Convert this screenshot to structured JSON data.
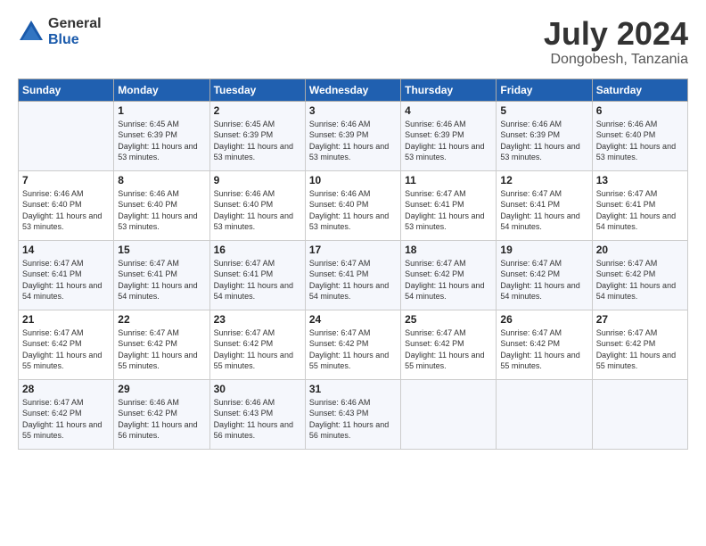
{
  "header": {
    "logo_general": "General",
    "logo_blue": "Blue",
    "title": "July 2024",
    "location": "Dongobesh, Tanzania"
  },
  "days_of_week": [
    "Sunday",
    "Monday",
    "Tuesday",
    "Wednesday",
    "Thursday",
    "Friday",
    "Saturday"
  ],
  "weeks": [
    [
      {
        "day": "",
        "info": ""
      },
      {
        "day": "1",
        "info": "Sunrise: 6:45 AM\nSunset: 6:39 PM\nDaylight: 11 hours\nand 53 minutes."
      },
      {
        "day": "2",
        "info": "Sunrise: 6:45 AM\nSunset: 6:39 PM\nDaylight: 11 hours\nand 53 minutes."
      },
      {
        "day": "3",
        "info": "Sunrise: 6:46 AM\nSunset: 6:39 PM\nDaylight: 11 hours\nand 53 minutes."
      },
      {
        "day": "4",
        "info": "Sunrise: 6:46 AM\nSunset: 6:39 PM\nDaylight: 11 hours\nand 53 minutes."
      },
      {
        "day": "5",
        "info": "Sunrise: 6:46 AM\nSunset: 6:39 PM\nDaylight: 11 hours\nand 53 minutes."
      },
      {
        "day": "6",
        "info": "Sunrise: 6:46 AM\nSunset: 6:40 PM\nDaylight: 11 hours\nand 53 minutes."
      }
    ],
    [
      {
        "day": "7",
        "info": "Sunrise: 6:46 AM\nSunset: 6:40 PM\nDaylight: 11 hours\nand 53 minutes."
      },
      {
        "day": "8",
        "info": "Sunrise: 6:46 AM\nSunset: 6:40 PM\nDaylight: 11 hours\nand 53 minutes."
      },
      {
        "day": "9",
        "info": "Sunrise: 6:46 AM\nSunset: 6:40 PM\nDaylight: 11 hours\nand 53 minutes."
      },
      {
        "day": "10",
        "info": "Sunrise: 6:46 AM\nSunset: 6:40 PM\nDaylight: 11 hours\nand 53 minutes."
      },
      {
        "day": "11",
        "info": "Sunrise: 6:47 AM\nSunset: 6:41 PM\nDaylight: 11 hours\nand 53 minutes."
      },
      {
        "day": "12",
        "info": "Sunrise: 6:47 AM\nSunset: 6:41 PM\nDaylight: 11 hours\nand 54 minutes."
      },
      {
        "day": "13",
        "info": "Sunrise: 6:47 AM\nSunset: 6:41 PM\nDaylight: 11 hours\nand 54 minutes."
      }
    ],
    [
      {
        "day": "14",
        "info": "Sunrise: 6:47 AM\nSunset: 6:41 PM\nDaylight: 11 hours\nand 54 minutes."
      },
      {
        "day": "15",
        "info": "Sunrise: 6:47 AM\nSunset: 6:41 PM\nDaylight: 11 hours\nand 54 minutes."
      },
      {
        "day": "16",
        "info": "Sunrise: 6:47 AM\nSunset: 6:41 PM\nDaylight: 11 hours\nand 54 minutes."
      },
      {
        "day": "17",
        "info": "Sunrise: 6:47 AM\nSunset: 6:41 PM\nDaylight: 11 hours\nand 54 minutes."
      },
      {
        "day": "18",
        "info": "Sunrise: 6:47 AM\nSunset: 6:42 PM\nDaylight: 11 hours\nand 54 minutes."
      },
      {
        "day": "19",
        "info": "Sunrise: 6:47 AM\nSunset: 6:42 PM\nDaylight: 11 hours\nand 54 minutes."
      },
      {
        "day": "20",
        "info": "Sunrise: 6:47 AM\nSunset: 6:42 PM\nDaylight: 11 hours\nand 54 minutes."
      }
    ],
    [
      {
        "day": "21",
        "info": "Sunrise: 6:47 AM\nSunset: 6:42 PM\nDaylight: 11 hours\nand 55 minutes."
      },
      {
        "day": "22",
        "info": "Sunrise: 6:47 AM\nSunset: 6:42 PM\nDaylight: 11 hours\nand 55 minutes."
      },
      {
        "day": "23",
        "info": "Sunrise: 6:47 AM\nSunset: 6:42 PM\nDaylight: 11 hours\nand 55 minutes."
      },
      {
        "day": "24",
        "info": "Sunrise: 6:47 AM\nSunset: 6:42 PM\nDaylight: 11 hours\nand 55 minutes."
      },
      {
        "day": "25",
        "info": "Sunrise: 6:47 AM\nSunset: 6:42 PM\nDaylight: 11 hours\nand 55 minutes."
      },
      {
        "day": "26",
        "info": "Sunrise: 6:47 AM\nSunset: 6:42 PM\nDaylight: 11 hours\nand 55 minutes."
      },
      {
        "day": "27",
        "info": "Sunrise: 6:47 AM\nSunset: 6:42 PM\nDaylight: 11 hours\nand 55 minutes."
      }
    ],
    [
      {
        "day": "28",
        "info": "Sunrise: 6:47 AM\nSunset: 6:42 PM\nDaylight: 11 hours\nand 55 minutes."
      },
      {
        "day": "29",
        "info": "Sunrise: 6:46 AM\nSunset: 6:42 PM\nDaylight: 11 hours\nand 56 minutes."
      },
      {
        "day": "30",
        "info": "Sunrise: 6:46 AM\nSunset: 6:43 PM\nDaylight: 11 hours\nand 56 minutes."
      },
      {
        "day": "31",
        "info": "Sunrise: 6:46 AM\nSunset: 6:43 PM\nDaylight: 11 hours\nand 56 minutes."
      },
      {
        "day": "",
        "info": ""
      },
      {
        "day": "",
        "info": ""
      },
      {
        "day": "",
        "info": ""
      }
    ]
  ]
}
